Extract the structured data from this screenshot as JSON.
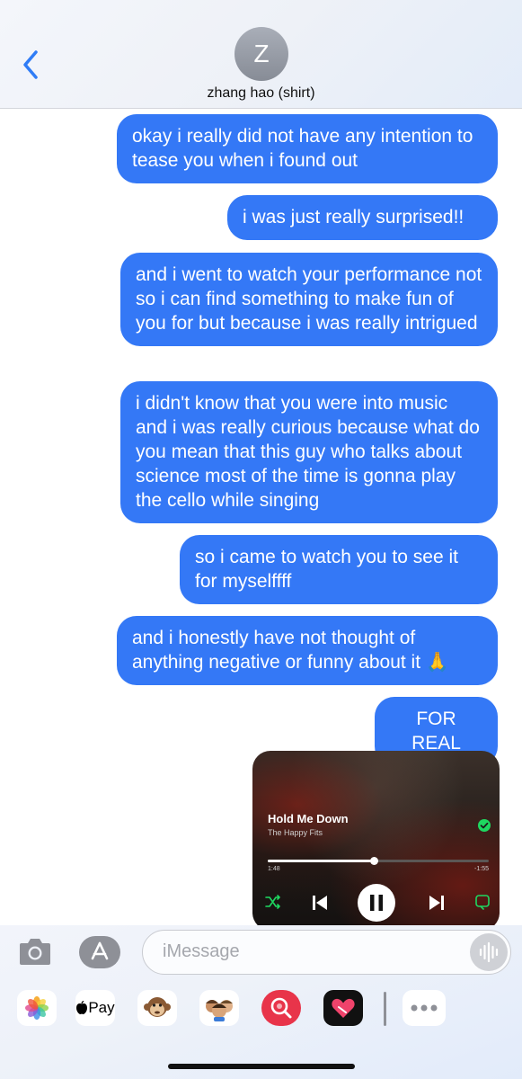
{
  "header": {
    "avatar_initial": "Z",
    "contact_name": "zhang hao (shirt)"
  },
  "messages": [
    {
      "text": "okay i really did not have any intention to tease you when i found out",
      "from": "me"
    },
    {
      "text": "i was just really surprised!!",
      "from": "me"
    },
    {
      "text": "and i went to watch your performance not so i can find something to make fun of you for but because i was really intrigued",
      "from": "me"
    },
    {
      "text": "i didn't know that you were into music and i was really curious because what do you mean that this guy who talks about science most of the time is gonna play the cello while singing",
      "from": "me"
    },
    {
      "text": "so i came to watch you to see it for myselffff",
      "from": "me"
    },
    {
      "text": "and i honestly have not thought of anything negative or funny about it 🙏",
      "from": "me"
    },
    {
      "text": "FOR REAL",
      "from": "me"
    }
  ],
  "player": {
    "song_title": "Hold Me Down",
    "artist": "The Happy Fits",
    "elapsed": "1:48",
    "remaining": "-1:55",
    "progress": 0.48
  },
  "composer": {
    "placeholder": "iMessage"
  },
  "app_tray": {
    "apple_pay_label": "Pay",
    "apps": [
      "photos-icon",
      "apple-pay-icon",
      "memoji-monkey-icon",
      "memoji-group-icon",
      "search-images-icon",
      "digital-touch-icon",
      "more-icon"
    ]
  },
  "colors": {
    "bubble_blue": "#3478f6",
    "ios_blue": "#2f7cf6",
    "spotify_green": "#1ed760"
  }
}
